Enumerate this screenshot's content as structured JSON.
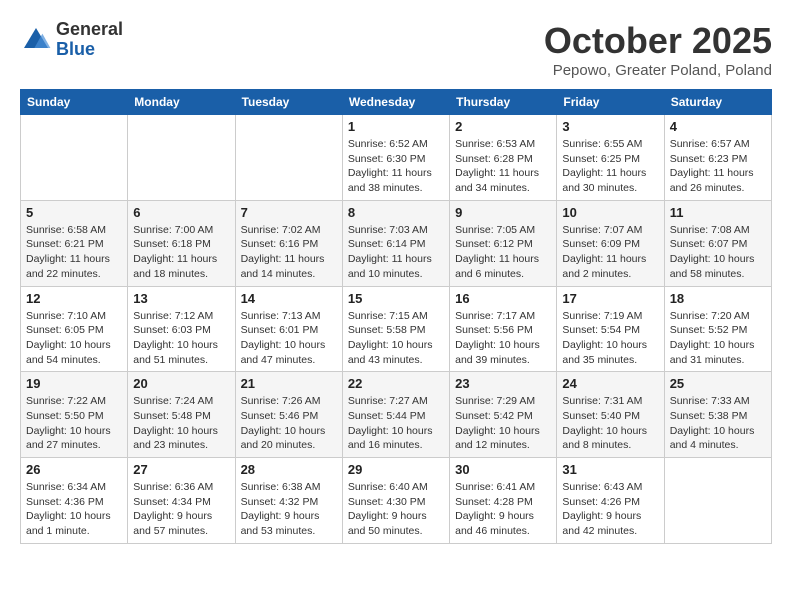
{
  "header": {
    "logo_general": "General",
    "logo_blue": "Blue",
    "month": "October 2025",
    "location": "Pepowo, Greater Poland, Poland"
  },
  "days_of_week": [
    "Sunday",
    "Monday",
    "Tuesday",
    "Wednesday",
    "Thursday",
    "Friday",
    "Saturday"
  ],
  "weeks": [
    [
      {
        "day": "",
        "info": ""
      },
      {
        "day": "",
        "info": ""
      },
      {
        "day": "",
        "info": ""
      },
      {
        "day": "1",
        "info": "Sunrise: 6:52 AM\nSunset: 6:30 PM\nDaylight: 11 hours and 38 minutes."
      },
      {
        "day": "2",
        "info": "Sunrise: 6:53 AM\nSunset: 6:28 PM\nDaylight: 11 hours and 34 minutes."
      },
      {
        "day": "3",
        "info": "Sunrise: 6:55 AM\nSunset: 6:25 PM\nDaylight: 11 hours and 30 minutes."
      },
      {
        "day": "4",
        "info": "Sunrise: 6:57 AM\nSunset: 6:23 PM\nDaylight: 11 hours and 26 minutes."
      }
    ],
    [
      {
        "day": "5",
        "info": "Sunrise: 6:58 AM\nSunset: 6:21 PM\nDaylight: 11 hours and 22 minutes."
      },
      {
        "day": "6",
        "info": "Sunrise: 7:00 AM\nSunset: 6:18 PM\nDaylight: 11 hours and 18 minutes."
      },
      {
        "day": "7",
        "info": "Sunrise: 7:02 AM\nSunset: 6:16 PM\nDaylight: 11 hours and 14 minutes."
      },
      {
        "day": "8",
        "info": "Sunrise: 7:03 AM\nSunset: 6:14 PM\nDaylight: 11 hours and 10 minutes."
      },
      {
        "day": "9",
        "info": "Sunrise: 7:05 AM\nSunset: 6:12 PM\nDaylight: 11 hours and 6 minutes."
      },
      {
        "day": "10",
        "info": "Sunrise: 7:07 AM\nSunset: 6:09 PM\nDaylight: 11 hours and 2 minutes."
      },
      {
        "day": "11",
        "info": "Sunrise: 7:08 AM\nSunset: 6:07 PM\nDaylight: 10 hours and 58 minutes."
      }
    ],
    [
      {
        "day": "12",
        "info": "Sunrise: 7:10 AM\nSunset: 6:05 PM\nDaylight: 10 hours and 54 minutes."
      },
      {
        "day": "13",
        "info": "Sunrise: 7:12 AM\nSunset: 6:03 PM\nDaylight: 10 hours and 51 minutes."
      },
      {
        "day": "14",
        "info": "Sunrise: 7:13 AM\nSunset: 6:01 PM\nDaylight: 10 hours and 47 minutes."
      },
      {
        "day": "15",
        "info": "Sunrise: 7:15 AM\nSunset: 5:58 PM\nDaylight: 10 hours and 43 minutes."
      },
      {
        "day": "16",
        "info": "Sunrise: 7:17 AM\nSunset: 5:56 PM\nDaylight: 10 hours and 39 minutes."
      },
      {
        "day": "17",
        "info": "Sunrise: 7:19 AM\nSunset: 5:54 PM\nDaylight: 10 hours and 35 minutes."
      },
      {
        "day": "18",
        "info": "Sunrise: 7:20 AM\nSunset: 5:52 PM\nDaylight: 10 hours and 31 minutes."
      }
    ],
    [
      {
        "day": "19",
        "info": "Sunrise: 7:22 AM\nSunset: 5:50 PM\nDaylight: 10 hours and 27 minutes."
      },
      {
        "day": "20",
        "info": "Sunrise: 7:24 AM\nSunset: 5:48 PM\nDaylight: 10 hours and 23 minutes."
      },
      {
        "day": "21",
        "info": "Sunrise: 7:26 AM\nSunset: 5:46 PM\nDaylight: 10 hours and 20 minutes."
      },
      {
        "day": "22",
        "info": "Sunrise: 7:27 AM\nSunset: 5:44 PM\nDaylight: 10 hours and 16 minutes."
      },
      {
        "day": "23",
        "info": "Sunrise: 7:29 AM\nSunset: 5:42 PM\nDaylight: 10 hours and 12 minutes."
      },
      {
        "day": "24",
        "info": "Sunrise: 7:31 AM\nSunset: 5:40 PM\nDaylight: 10 hours and 8 minutes."
      },
      {
        "day": "25",
        "info": "Sunrise: 7:33 AM\nSunset: 5:38 PM\nDaylight: 10 hours and 4 minutes."
      }
    ],
    [
      {
        "day": "26",
        "info": "Sunrise: 6:34 AM\nSunset: 4:36 PM\nDaylight: 10 hours and 1 minute."
      },
      {
        "day": "27",
        "info": "Sunrise: 6:36 AM\nSunset: 4:34 PM\nDaylight: 9 hours and 57 minutes."
      },
      {
        "day": "28",
        "info": "Sunrise: 6:38 AM\nSunset: 4:32 PM\nDaylight: 9 hours and 53 minutes."
      },
      {
        "day": "29",
        "info": "Sunrise: 6:40 AM\nSunset: 4:30 PM\nDaylight: 9 hours and 50 minutes."
      },
      {
        "day": "30",
        "info": "Sunrise: 6:41 AM\nSunset: 4:28 PM\nDaylight: 9 hours and 46 minutes."
      },
      {
        "day": "31",
        "info": "Sunrise: 6:43 AM\nSunset: 4:26 PM\nDaylight: 9 hours and 42 minutes."
      },
      {
        "day": "",
        "info": ""
      }
    ]
  ]
}
